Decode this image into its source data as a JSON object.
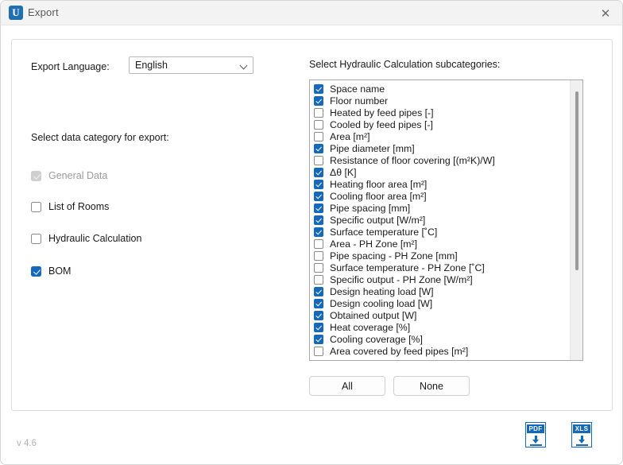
{
  "window": {
    "title": "Export",
    "logo_letter": "U",
    "close_label": "✕",
    "version": "v 4.6"
  },
  "left": {
    "export_language_label": "Export Language:",
    "language_value": "English",
    "language_options": [
      "English"
    ],
    "category_label": "Select data category for export:",
    "categories": [
      {
        "label": "General Data",
        "checked": true,
        "enabled": false
      },
      {
        "label": "List of Rooms",
        "checked": false,
        "enabled": true
      },
      {
        "label": "Hydraulic Calculation",
        "checked": false,
        "enabled": true
      },
      {
        "label": "BOM",
        "checked": true,
        "enabled": true
      }
    ]
  },
  "right": {
    "subcategories_label": "Select Hydraulic Calculation subcategories:",
    "items": [
      {
        "label": "Space name",
        "checked": true
      },
      {
        "label": "Floor number",
        "checked": true
      },
      {
        "label": "Heated by feed pipes [-]",
        "checked": false
      },
      {
        "label": "Cooled by feed pipes [-]",
        "checked": false
      },
      {
        "label": "Area [m²]",
        "checked": false
      },
      {
        "label": "Pipe diameter [mm]",
        "checked": true
      },
      {
        "label": "Resistance of floor covering [(m²K)/W]",
        "checked": false
      },
      {
        "label": "Δθ [K]",
        "checked": true
      },
      {
        "label": "Heating floor area [m²]",
        "checked": true
      },
      {
        "label": "Cooling floor area [m²]",
        "checked": true
      },
      {
        "label": "Pipe spacing [mm]",
        "checked": true
      },
      {
        "label": "Specific output [W/m²]",
        "checked": true
      },
      {
        "label": "Surface temperature [˚C]",
        "checked": true
      },
      {
        "label": "Area - PH Zone [m²]",
        "checked": false
      },
      {
        "label": "Pipe spacing - PH Zone [mm]",
        "checked": false
      },
      {
        "label": "Surface temperature - PH Zone [˚C]",
        "checked": false
      },
      {
        "label": "Specific output - PH Zone [W/m²]",
        "checked": false
      },
      {
        "label": "Design heating load [W]",
        "checked": true
      },
      {
        "label": "Design cooling load [W]",
        "checked": true
      },
      {
        "label": "Obtained output [W]",
        "checked": true
      },
      {
        "label": "Heat coverage [%]",
        "checked": true
      },
      {
        "label": "Cooling coverage [%]",
        "checked": true
      },
      {
        "label": "Area covered by feed pipes [m²]",
        "checked": false
      }
    ],
    "select_all_label": "All",
    "select_none_label": "None"
  },
  "export_buttons": [
    {
      "name": "pdf",
      "tag": "PDF"
    },
    {
      "name": "xls",
      "tag": "XLS"
    }
  ],
  "colors": {
    "accent": "#1569bd",
    "titlebar": "#f3f3f3",
    "disabled_check": "#cfcfcf",
    "muted_text": "#9b9b9b"
  }
}
